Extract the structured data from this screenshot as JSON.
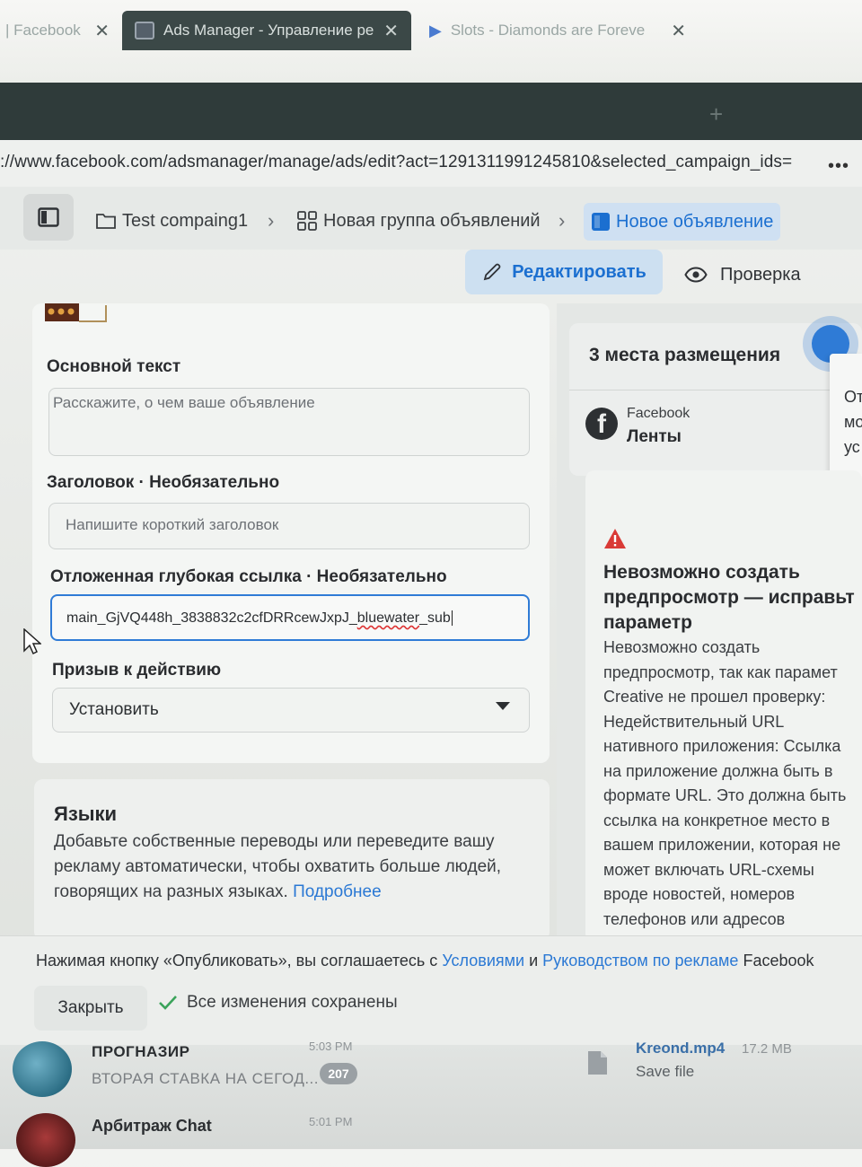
{
  "browser": {
    "tabs": [
      {
        "label": "| Facebook"
      },
      {
        "label": "Ads Manager - Управление ре"
      },
      {
        "label": "Slots - Diamonds are Foreve"
      }
    ],
    "close_glyph": "✕",
    "new_tab_glyph": "+",
    "url": "://www.facebook.com/adsmanager/manage/ads/edit?act=1291311991245810&selected_campaign_ids=",
    "more_glyph": "•••"
  },
  "breadcrumb": {
    "campaign": "Test compaing1",
    "adset": "Новая группа объявлений",
    "ad": "Новое объявление",
    "separator": "›"
  },
  "mode": {
    "edit_label": "Редактировать",
    "review_label": "Проверка"
  },
  "form": {
    "primary_text": {
      "label": "Основной текст",
      "placeholder": "Расскажите, о чем ваше объявление"
    },
    "headline": {
      "label": "Заголовок · Необязательно",
      "placeholder": "Напишите короткий заголовок"
    },
    "deeplink": {
      "label": "Отложенная глубокая ссылка · Необязательно",
      "value_start": "main_GjVQ448h_3838832c2cfDRRcewJxpJ_",
      "value_flagged": "bluewater",
      "value_end": "_sub"
    },
    "cta": {
      "label": "Призыв к действию",
      "value": "Установить"
    }
  },
  "languages": {
    "title": "Языки",
    "text": "Добавьте собственные переводы или переведите вашу рекламу автоматически, чтобы охватить больше людей, говорящих на разных языках. ",
    "link": "Подробнее"
  },
  "placements": {
    "title": "3 места размещения",
    "platform": "Facebook",
    "position": "Ленты",
    "popup_lines": [
      "От",
      "мо",
      "ус"
    ]
  },
  "preview_error": {
    "title_lines": [
      "Невозможно создать",
      "предпросмотр — исправьт",
      "параметр"
    ],
    "body_lines": [
      "Невозможно создать",
      "предпросмотр, так как парамет",
      "Creative не прошел проверку:",
      "Недействительный URL",
      "нативного приложения: Ссылка",
      "на приложение должна быть в",
      "формате URL. Это должна быть",
      "ссылка на конкретное место в",
      "вашем приложении, которая не",
      "может включать URL-схемы",
      "вроде новостей, номеров",
      "телефонов или адресов"
    ]
  },
  "footer": {
    "terms_prefix": "Нажимая кнопку «Опубликовать», вы соглашаетесь с ",
    "terms_link1": "Условиями",
    "terms_and": " и ",
    "terms_link2": "Руководством по рекламе",
    "terms_suffix": " Facebook",
    "close_label": "Закрыть",
    "saved_label": "Все изменения сохранены"
  },
  "telegram": {
    "chat1_name": "ПРОГНАЗИР",
    "chat1_preview": "ВТОРАЯ СТАВКА НА СЕГОД...",
    "chat1_time": "5:03 PM",
    "chat1_badge": "207",
    "chat2_name": "Арбитраж Chat",
    "chat2_time": "5:01 PM",
    "file_name": "Kreond.mp4",
    "file_size": "17.2 MB",
    "file_action": "Save file"
  },
  "colors": {
    "accent": "#2f7bd6",
    "link": "#2a78d4",
    "warning": "#d93a36",
    "success": "#3aa35a"
  }
}
